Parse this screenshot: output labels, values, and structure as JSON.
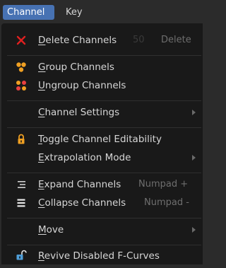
{
  "menubar": {
    "channel_tab": "Channel",
    "key_tab": "Key"
  },
  "menu": {
    "delete_channels": {
      "label": "Delete Channels",
      "underline": "D",
      "rest": "elete Channels",
      "shortcut": "Delete",
      "ghost": "50"
    },
    "group_channels": {
      "label": "Group Channels",
      "underline": "G",
      "rest": "roup Channels"
    },
    "ungroup_channels": {
      "label": "Ungroup Channels",
      "underline": "U",
      "rest": "ngroup Channels"
    },
    "channel_settings": {
      "label": "Channel Settings",
      "underline": "C",
      "rest": "hannel Settings"
    },
    "toggle_editability": {
      "label": "Toggle Channel Editability",
      "underline": "T",
      "rest": "oggle Channel Editability"
    },
    "extrapolation_mode": {
      "label": "Extrapolation Mode",
      "underline": "E",
      "rest": "xtrapolation Mode"
    },
    "expand_channels": {
      "label": "Expand Channels",
      "underline": "E",
      "rest": "xpand Channels",
      "shortcut": "Numpad +"
    },
    "collapse_channels": {
      "label": "Collapse Channels",
      "underline": "C",
      "rest": "ollapse Channels",
      "shortcut": "Numpad -"
    },
    "move": {
      "label": "Move",
      "underline": "M",
      "rest": "ove"
    },
    "revive_fcurves": {
      "label": "Revive Disabled F-Curves",
      "underline": "R",
      "rest": "evive Disabled F-Curves"
    }
  },
  "icons": {
    "delete": "x-icon",
    "group": "group-icon",
    "ungroup": "ungroup-icon",
    "lock": "lock-icon",
    "expand": "expand-icon",
    "collapse": "collapse-icon",
    "revive": "unlock-icon"
  },
  "colors": {
    "accent": "#4772b3",
    "delete_red": "#e02020",
    "orange": "#f0a022",
    "group_red": "#e84040",
    "menu_bg": "#191919"
  }
}
